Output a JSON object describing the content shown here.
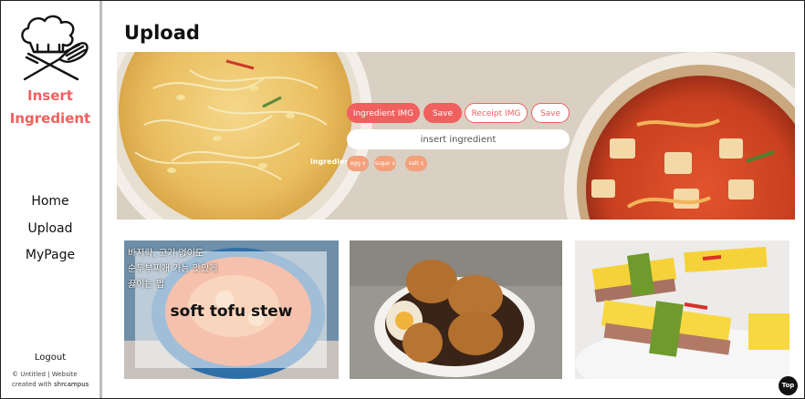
{
  "sidebar": {
    "brand_line1": "Insert",
    "brand_line2": "Ingredient",
    "nav": [
      "Home",
      "Upload",
      "MyPage"
    ],
    "logout": "Logout",
    "copyright_line": "© Untitled | Website created with",
    "copyright_author": "shrcampus"
  },
  "main": {
    "title": "Upload",
    "buttons": {
      "ingredient_img": "Ingredient IMG",
      "save1": "Save",
      "receipt_img": "Receipt IMG",
      "save2": "Save"
    },
    "ingredient_input_placeholder": "insert ingredient",
    "ingredient_label": "ingredient",
    "tags": [
      "egg x",
      "sugar x",
      "salt x"
    ],
    "cards": [
      {
        "korean_caption": "바지락, 고기 없이도\n순두부찌개 가능 맛있게\n끓이는 법",
        "title": "soft tofu stew"
      },
      {
        "korean_caption": "",
        "title": ""
      },
      {
        "korean_caption": "",
        "title": ""
      }
    ],
    "top_button": "Top"
  },
  "colors": {
    "accent": "#f0605f",
    "tag": "#f3a07b",
    "divider": "#bdbdbd"
  }
}
